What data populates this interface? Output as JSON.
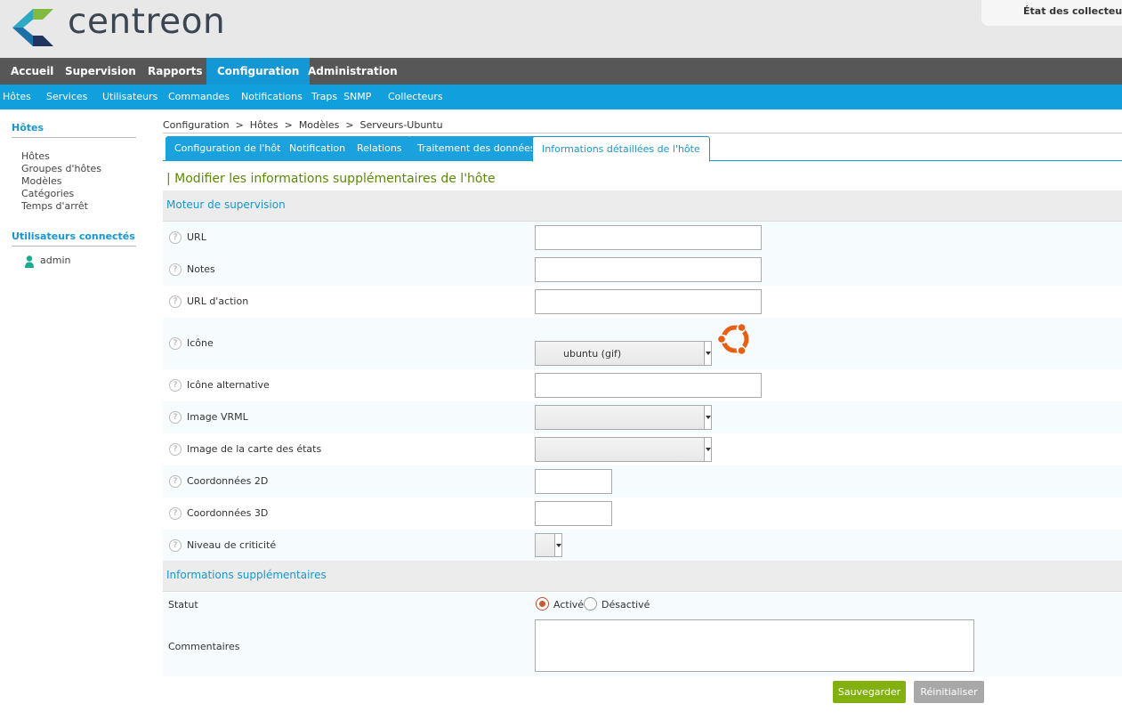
{
  "header": {
    "brand": "centreon",
    "poller_label": "État des collecteurs"
  },
  "topnav": [
    "Accueil",
    "Supervision",
    "Rapports",
    "Configuration",
    "Administration"
  ],
  "topnav_active": "Configuration",
  "subnav": [
    "Hôtes",
    "Services",
    "Utilisateurs",
    "Commandes",
    "Notifications",
    "Traps  SNMP",
    "Collecteurs"
  ],
  "sidebar": {
    "hosts_heading": "Hôtes",
    "hosts_items": [
      "Hôtes",
      "Groupes d'hôtes",
      "Modèles",
      "Catégories",
      "Temps d'arrêt"
    ],
    "users_heading": "Utilisateurs connectés",
    "users": [
      "admin"
    ]
  },
  "breadcrumb": "Configuration  >  Hôtes  >  Modèles  >  Serveurs-Ubuntu",
  "tabs": [
    "Configuration de l'hôte",
    "Notification",
    "Relations",
    "Traitement des données",
    "Informations détaillées de l'hôte"
  ],
  "form": {
    "title": "| Modifier les informations supplémentaires de l'hôte",
    "section1": "Moteur de supervision",
    "fields": {
      "url": "URL",
      "notes": "Notes",
      "action_url": "URL d'action",
      "icon": "Icône",
      "icon_value": "ubuntu (gif)",
      "alt_icon": "Icône alternative",
      "vrml": "Image VRML",
      "statusmap": "Image de la carte des états",
      "coords2d": "Coordonnées 2D",
      "coords3d": "Coordonnées 3D",
      "criticality": "Niveau de criticité"
    },
    "help": "?",
    "section2": "Informations supplémentaires",
    "status_label": "Statut",
    "status_on": "Activé",
    "status_off": "Désactivé",
    "comments_label": "Commentaires"
  },
  "buttons": {
    "save": "Sauvegarder",
    "reset": "Réinitialiser"
  },
  "colors": {
    "primary": "#1498d5",
    "save": "#82b00f",
    "title": "#5a8a00"
  }
}
